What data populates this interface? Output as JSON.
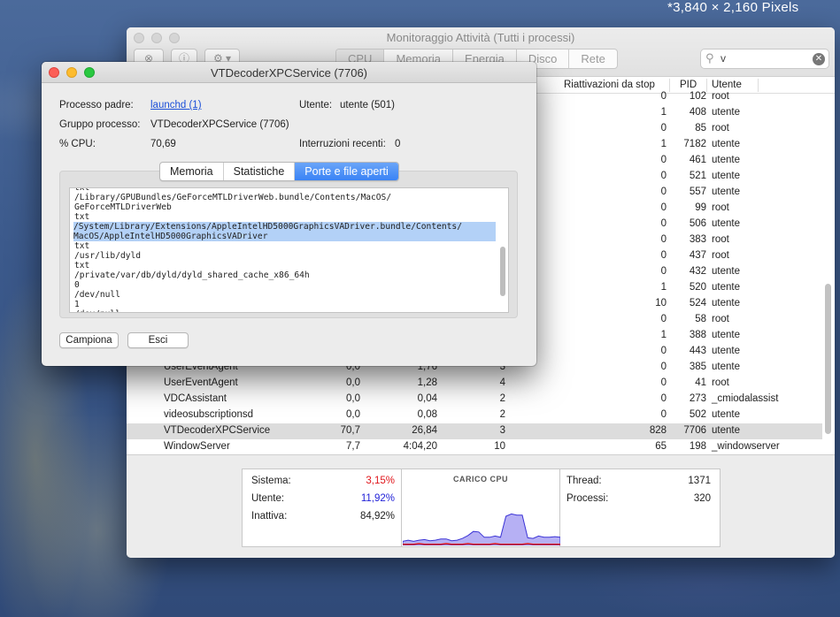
{
  "screen_label": "*3,840 × 2,160 Pixels",
  "main_window": {
    "title": "Monitoraggio Attività (Tutti i processi)",
    "tabs": [
      "CPU",
      "Memoria",
      "Energia",
      "Disco",
      "Rete"
    ],
    "search_value": "v",
    "columns": {
      "wake": "Riattivazioni da stop",
      "pid": "PID",
      "user": "Utente"
    },
    "rows": [
      {
        "name": "",
        "cpu": "",
        "time": "",
        "threads": "",
        "wake": "0",
        "pid": "102",
        "user": "root"
      },
      {
        "name": "",
        "cpu": "",
        "time": "",
        "threads": "",
        "wake": "1",
        "pid": "408",
        "user": "utente"
      },
      {
        "name": "",
        "cpu": "",
        "time": "",
        "threads": "",
        "wake": "0",
        "pid": "85",
        "user": "root"
      },
      {
        "name": "",
        "cpu": "",
        "time": "",
        "threads": "",
        "wake": "1",
        "pid": "7182",
        "user": "utente"
      },
      {
        "name": "",
        "cpu": "",
        "time": "",
        "threads": "",
        "wake": "0",
        "pid": "461",
        "user": "utente"
      },
      {
        "name": "",
        "cpu": "",
        "time": "",
        "threads": "",
        "wake": "0",
        "pid": "521",
        "user": "utente"
      },
      {
        "name": "",
        "cpu": "",
        "time": "",
        "threads": "",
        "wake": "0",
        "pid": "557",
        "user": "utente"
      },
      {
        "name": "",
        "cpu": "",
        "time": "",
        "threads": "",
        "wake": "0",
        "pid": "99",
        "user": "root"
      },
      {
        "name": "",
        "cpu": "",
        "time": "",
        "threads": "",
        "wake": "0",
        "pid": "506",
        "user": "utente"
      },
      {
        "name": "",
        "cpu": "",
        "time": "",
        "threads": "",
        "wake": "0",
        "pid": "383",
        "user": "root"
      },
      {
        "name": "",
        "cpu": "",
        "time": "",
        "threads": "",
        "wake": "0",
        "pid": "437",
        "user": "root"
      },
      {
        "name": "",
        "cpu": "",
        "time": "",
        "threads": "",
        "wake": "0",
        "pid": "432",
        "user": "utente"
      },
      {
        "name": "",
        "cpu": "",
        "time": "",
        "threads": "",
        "wake": "1",
        "pid": "520",
        "user": "utente"
      },
      {
        "name": "",
        "cpu": "",
        "time": "",
        "threads": "",
        "wake": "10",
        "pid": "524",
        "user": "utente"
      },
      {
        "name": "",
        "cpu": "",
        "time": "",
        "threads": "",
        "wake": "0",
        "pid": "58",
        "user": "root"
      },
      {
        "name": "",
        "cpu": "",
        "time": "",
        "threads": "",
        "wake": "1",
        "pid": "388",
        "user": "utente"
      },
      {
        "name": "",
        "cpu": "",
        "time": "",
        "threads": "",
        "wake": "0",
        "pid": "443",
        "user": "utente"
      },
      {
        "name": "UserEventAgent",
        "cpu": "0,0",
        "time": "1,76",
        "threads": "3",
        "wake": "0",
        "pid": "385",
        "user": "utente"
      },
      {
        "name": "UserEventAgent",
        "cpu": "0,0",
        "time": "1,28",
        "threads": "4",
        "wake": "0",
        "pid": "41",
        "user": "root"
      },
      {
        "name": "VDCAssistant",
        "cpu": "0,0",
        "time": "0,04",
        "threads": "2",
        "wake": "0",
        "pid": "273",
        "user": "_cmiodalassist"
      },
      {
        "name": "videosubscriptionsd",
        "cpu": "0,0",
        "time": "0,08",
        "threads": "2",
        "wake": "0",
        "pid": "502",
        "user": "utente"
      },
      {
        "name": "VTDecoderXPCService",
        "cpu": "70,7",
        "time": "26,84",
        "threads": "3",
        "wake": "828",
        "pid": "7706",
        "user": "utente",
        "selected": true
      },
      {
        "name": "WindowServer",
        "cpu": "7,7",
        "time": "4:04,20",
        "threads": "10",
        "wake": "65",
        "pid": "198",
        "user": "_windowserver"
      }
    ],
    "stats": {
      "sistema_label": "Sistema:",
      "sistema_value": "3,15%",
      "utente_label": "Utente:",
      "utente_value": "11,92%",
      "inattiva_label": "Inattiva:",
      "inattiva_value": "84,92%",
      "graph_title": "CARICO CPU",
      "thread_label": "Thread:",
      "thread_value": "1371",
      "processi_label": "Processi:",
      "processi_value": "320",
      "sistema_color": "#e0161b",
      "utente_color": "#2323d8"
    }
  },
  "inspector": {
    "title": "VTDecoderXPCService (7706)",
    "parent_label": "Processo padre:",
    "parent_value": "launchd (1)",
    "user_label": "Utente:",
    "user_value": "utente (501)",
    "group_label": "Gruppo processo:",
    "group_value": "VTDecoderXPCService (7706)",
    "cpu_label": "% CPU:",
    "cpu_value": "70,69",
    "interrupts_label": "Interruzioni recenti:",
    "interrupts_value": "0",
    "tabs": [
      "Memoria",
      "Statistiche",
      "Porte e file aperti"
    ],
    "active_tab": 2,
    "files": [
      "txt",
      "/Library/GPUBundles/GeForceMTLDriverWeb.bundle/Contents/MacOS/",
      "GeForceMTLDriverWeb",
      "txt",
      "/System/Library/Extensions/AppleIntelHD5000GraphicsVADriver.bundle/Contents/",
      "MacOS/AppleIntelHD5000GraphicsVADriver",
      "txt",
      "/usr/lib/dyld",
      "txt",
      "/private/var/db/dyld/dyld_shared_cache_x86_64h",
      "0",
      "/dev/null",
      "1",
      "/dev/null"
    ],
    "highlighted_lines": [
      4,
      5
    ],
    "sample_button": "Campiona",
    "quit_button": "Esci"
  },
  "cpu_load": {
    "system": [
      0.02,
      0.02,
      0.02,
      0.03,
      0.02,
      0.02,
      0.02,
      0.02,
      0.03,
      0.02,
      0.02,
      0.02,
      0.03,
      0.02,
      0.02,
      0.02,
      0.02,
      0.03,
      0.02,
      0.02,
      0.02,
      0.02,
      0.02,
      0.03,
      0.02,
      0.02,
      0.02,
      0.02,
      0.02,
      0.02
    ],
    "user": [
      0.05,
      0.07,
      0.05,
      0.06,
      0.08,
      0.06,
      0.07,
      0.09,
      0.08,
      0.06,
      0.07,
      0.1,
      0.14,
      0.22,
      0.21,
      0.12,
      0.12,
      0.13,
      0.12,
      0.48,
      0.52,
      0.5,
      0.5,
      0.1,
      0.1,
      0.14,
      0.12,
      0.12,
      0.13,
      0.12
    ]
  }
}
